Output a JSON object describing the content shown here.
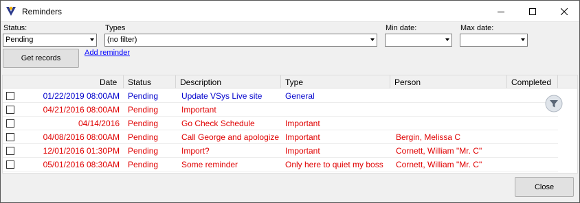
{
  "window": {
    "title": "Reminders"
  },
  "filters": {
    "status_label": "Status:",
    "status_value": "Pending",
    "types_label": "Types",
    "types_value": "(no filter)",
    "min_date_label": "Min date:",
    "min_date_value": "",
    "max_date_label": "Max date:",
    "max_date_value": ""
  },
  "actions": {
    "get_records_label": "Get records",
    "add_reminder_label": "Add reminder",
    "close_label": "Close"
  },
  "grid": {
    "columns": [
      "Date",
      "Status",
      "Description",
      "Type",
      "Person",
      "Completed"
    ],
    "rows": [
      {
        "date": "01/22/2019 08:00AM",
        "status": "Pending",
        "description": "Update VSys Live site",
        "type": "General",
        "person": "",
        "color": "#0000cc"
      },
      {
        "date": "04/21/2016 08:00AM",
        "status": "Pending",
        "description": "Important",
        "type": "",
        "person": "",
        "color": "#e00000"
      },
      {
        "date": "04/14/2016",
        "status": "Pending",
        "description": "Go Check Schedule",
        "type": "Important",
        "person": "",
        "color": "#e00000"
      },
      {
        "date": "04/08/2016 08:00AM",
        "status": "Pending",
        "description": "Call George and apologize",
        "type": "Important",
        "person": "Bergin, Melissa C",
        "color": "#e00000"
      },
      {
        "date": "12/01/2016 01:30PM",
        "status": "Pending",
        "description": "Import?",
        "type": "Important",
        "person": "Cornett, William \"Mr. C\"",
        "color": "#e00000"
      },
      {
        "date": "05/01/2016 08:30AM",
        "status": "Pending",
        "description": "Some reminder",
        "type": "Only here to quiet my boss",
        "person": "Cornett, William \"Mr. C\"",
        "color": "#e00000"
      }
    ]
  },
  "colors": {
    "accent_blue": "#0000cc",
    "accent_red": "#e00000"
  }
}
